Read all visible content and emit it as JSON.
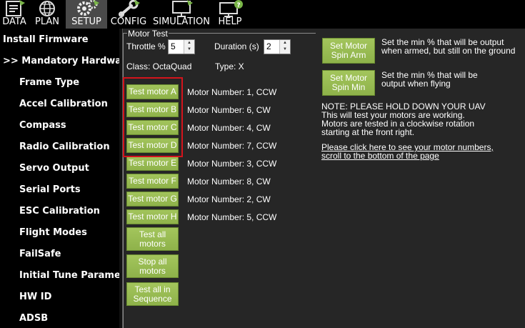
{
  "menu": {
    "items": [
      {
        "label": "DATA",
        "icon": "data-icon"
      },
      {
        "label": "PLAN",
        "icon": "globe-icon"
      },
      {
        "label": "SETUP",
        "icon": "gears-icon",
        "active": true
      },
      {
        "label": "CONFIG",
        "icon": "wrench-icon"
      },
      {
        "label": "SIMULATION",
        "icon": "monitor-icon"
      },
      {
        "label": "HELP",
        "icon": "help-monitor-icon"
      }
    ]
  },
  "sidebar": {
    "items": [
      {
        "label": "Install Firmware",
        "level": 0
      },
      {
        "label": ">> Mandatory Hardware",
        "level": 0
      },
      {
        "label": "Frame Type",
        "level": 1
      },
      {
        "label": "Accel Calibration",
        "level": 1
      },
      {
        "label": "Compass",
        "level": 1
      },
      {
        "label": "Radio Calibration",
        "level": 1
      },
      {
        "label": "Servo Output",
        "level": 1
      },
      {
        "label": "Serial Ports",
        "level": 1
      },
      {
        "label": "ESC Calibration",
        "level": 1
      },
      {
        "label": "Flight Modes",
        "level": 1
      },
      {
        "label": "FailSafe",
        "level": 1
      },
      {
        "label": "Initial Tune Paramete",
        "level": 1
      },
      {
        "label": "HW ID",
        "level": 1
      },
      {
        "label": "ADSB",
        "level": 1
      }
    ]
  },
  "motor_test": {
    "group_title": "Motor Test",
    "throttle_label": "Throttle %",
    "throttle_value": "5",
    "duration_label": "Duration (s)",
    "duration_value": "2",
    "class_label": "Class: OctaQuad",
    "type_label": "Type: X",
    "motors": [
      {
        "button": "Test motor A",
        "info": "Motor Number: 1, CCW"
      },
      {
        "button": "Test motor B",
        "info": "Motor Number: 6, CW"
      },
      {
        "button": "Test motor C",
        "info": "Motor Number: 4, CW"
      },
      {
        "button": "Test motor D",
        "info": "Motor Number: 7, CCW"
      },
      {
        "button": "Test motor E",
        "info": "Motor Number: 3, CCW"
      },
      {
        "button": "Test motor F",
        "info": "Motor Number: 8, CW"
      },
      {
        "button": "Test motor G",
        "info": "Motor Number: 2, CW"
      },
      {
        "button": "Test motor H",
        "info": "Motor Number: 5, CCW"
      }
    ],
    "test_all_label": "Test all motors",
    "stop_all_label": "Stop all motors",
    "sequence_label": "Test all in Sequence",
    "set_spin_arm_label": "Set Motor Spin Arm",
    "spin_arm_desc": "Set the min % that will be output when armed, but still on the ground",
    "set_spin_min_label": "Set Motor Spin Min",
    "spin_min_desc": "Set the min % that will be output when flying",
    "note_lines": [
      "NOTE: PLEASE HOLD DOWN YOUR UAV",
      "This will test your motors are working.",
      "Motors are tested in a clockwise rotation",
      "starting at the front right."
    ],
    "link_lines": [
      "Please click here to see your motor numbers,",
      "scroll to the bottom of the page"
    ]
  },
  "colors": {
    "button_green": "#8eb24a",
    "highlight_red": "#d4141c",
    "background": "#262626"
  }
}
